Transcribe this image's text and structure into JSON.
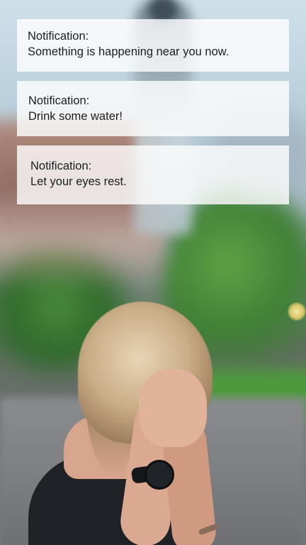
{
  "notifications": [
    {
      "title": "Notification:",
      "message": "Something is happening near you now."
    },
    {
      "title": "Notification:",
      "message": "Drink some water!"
    },
    {
      "title": "Notification:",
      "message": "Let your eyes rest."
    }
  ],
  "colors": {
    "card_background": "#ffffff",
    "text": "#1b1d20"
  }
}
